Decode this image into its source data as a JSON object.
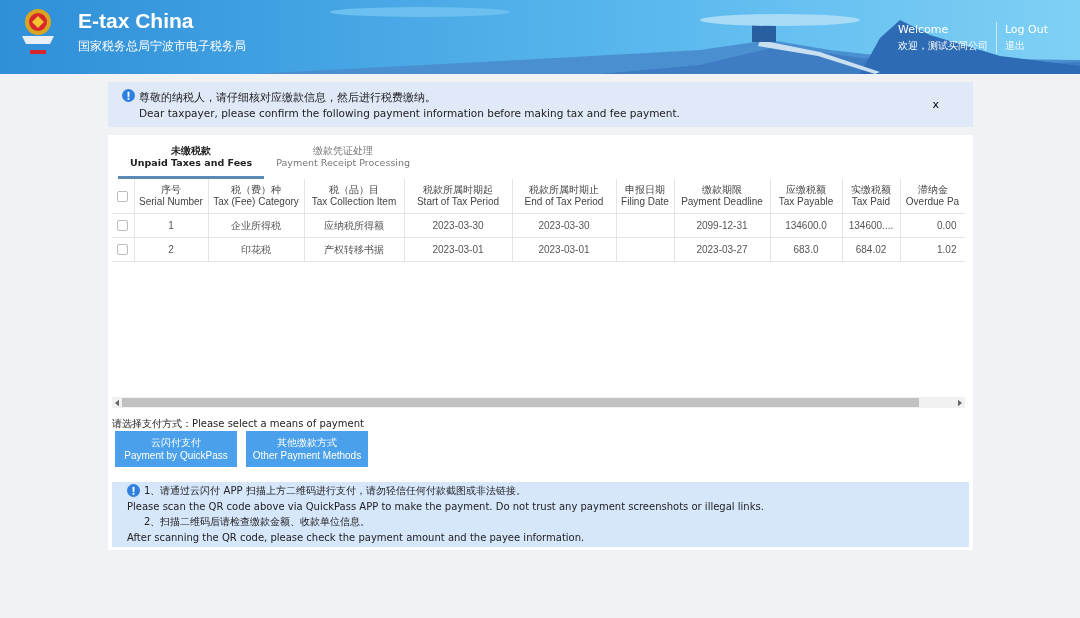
{
  "header": {
    "title": "E-tax China",
    "subtitle": "国家税务总局宁波市电子税务局",
    "welcome_en": "Welcome",
    "welcome_zh": "欢迎，测试买间公司",
    "logout_en": "Log Out",
    "logout_zh": "退出"
  },
  "notice": {
    "line_zh": "尊敬的纳税人，请仔细核对应缴款信息，然后进行税费缴纳。",
    "line_en": "Dear taxpayer, please confirm the following payment information before making tax and fee payment.",
    "close": "x"
  },
  "tabs": [
    {
      "zh": "未缴税款",
      "en": "Unpaid Taxes and Fees",
      "selected": true
    },
    {
      "zh": "缴款凭证处理",
      "en": "Payment Receipt Processing",
      "selected": false
    }
  ],
  "table": {
    "all_checked": false,
    "columns": [
      {
        "zh": "序号",
        "en": "Serial Number"
      },
      {
        "zh": "税（费）种",
        "en": "Tax (Fee) Category"
      },
      {
        "zh": "税（品）目",
        "en": "Tax Collection Item"
      },
      {
        "zh": "税款所属时期起",
        "en": "Start of Tax Period"
      },
      {
        "zh": "税款所属时期止",
        "en": "End of Tax Period"
      },
      {
        "zh": "申报日期",
        "en": "Filing Date"
      },
      {
        "zh": "缴款期限",
        "en": "Payment Deadline"
      },
      {
        "zh": "应缴税额",
        "en": "Tax Payable"
      },
      {
        "zh": "实缴税额",
        "en": "Tax Paid"
      },
      {
        "zh": "滞纳金",
        "en": "Overdue Pa"
      }
    ],
    "rows": [
      {
        "checked": false,
        "cells": [
          "1",
          "企业所得税",
          "应纳税所得额",
          "2023-03-30",
          "2023-03-30",
          "",
          "2099-12-31",
          "134600.0",
          "134600....",
          "0.00"
        ]
      },
      {
        "checked": false,
        "cells": [
          "2",
          "印花税",
          "产权转移书据",
          "2023-03-01",
          "2023-03-01",
          "",
          "2023-03-27",
          "683.0",
          "684.02",
          "1.02"
        ]
      }
    ]
  },
  "payment": {
    "prompt": "请选择支付方式：Please select a means of payment",
    "buttons": [
      {
        "zh": "云闪付支付",
        "en": "Payment by QuickPass"
      },
      {
        "zh": "其他缴款方式",
        "en": "Other Payment Methods"
      }
    ]
  },
  "tips": [
    "1、请通过云闪付 APP 扫描上方二维码进行支付，请勿轻信任何付款截图或非法链接。",
    "Please scan the QR code above via QuickPass APP to make the payment. Do not trust any payment screenshots or illegal links.",
    "2、扫描二维码后请检查缴款金额、收款单位信息。",
    "After scanning the QR code, please check the payment amount and the payee information."
  ]
}
